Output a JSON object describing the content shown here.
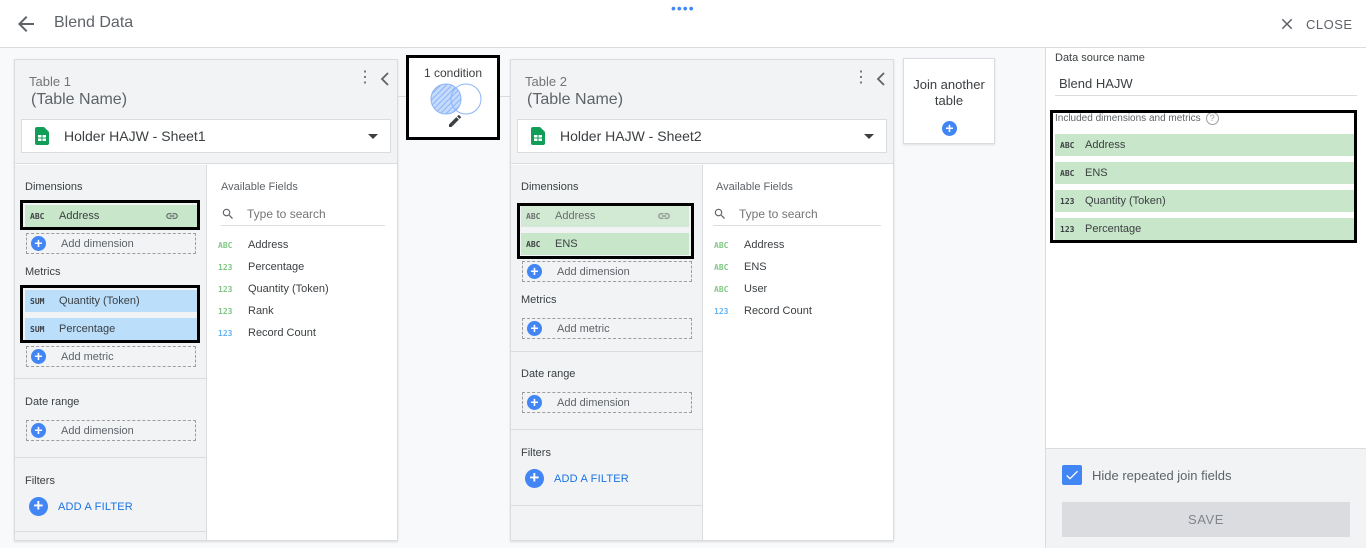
{
  "header": {
    "title": "Blend Data",
    "drag_handle": "••••",
    "close_label": "CLOSE"
  },
  "table1": {
    "label": "Table 1",
    "name": "(Table Name)",
    "source": "Holder HAJW - Sheet1",
    "dimensions_title": "Dimensions",
    "dimensions": [
      {
        "type": "ABC",
        "label": "Address"
      }
    ],
    "add_dimension": "Add dimension",
    "metrics_title": "Metrics",
    "metrics": [
      {
        "type": "SUM",
        "label": "Quantity (Token)"
      },
      {
        "type": "SUM",
        "label": "Percentage"
      }
    ],
    "add_metric": "Add metric",
    "date_range_title": "Date range",
    "date_add_dimension": "Add dimension",
    "filters_title": "Filters",
    "add_filter": "ADD A FILTER",
    "available_title": "Available Fields",
    "search_placeholder": "Type to search",
    "fields": [
      {
        "type": "ABC",
        "label": "Address"
      },
      {
        "type": "123",
        "label": "Percentage"
      },
      {
        "type": "123",
        "label": "Quantity (Token)"
      },
      {
        "type": "123",
        "label": "Rank"
      },
      {
        "type": "123",
        "label": "Record Count"
      }
    ]
  },
  "condition": {
    "label": "1 condition"
  },
  "table2": {
    "label": "Table 2",
    "name": "(Table Name)",
    "source": "Holder HAJW - Sheet2",
    "dimensions_title": "Dimensions",
    "dimensions": [
      {
        "type": "ABC",
        "label": "Address"
      },
      {
        "type": "ABC",
        "label": "ENS"
      }
    ],
    "add_dimension": "Add dimension",
    "metrics_title": "Metrics",
    "add_metric": "Add metric",
    "date_range_title": "Date range",
    "date_add_dimension": "Add dimension",
    "filters_title": "Filters",
    "add_filter": "ADD A FILTER",
    "available_title": "Available Fields",
    "search_placeholder": "Type to search",
    "fields": [
      {
        "type": "ABC",
        "label": "Address"
      },
      {
        "type": "ABC",
        "label": "ENS"
      },
      {
        "type": "ABC",
        "label": "User"
      },
      {
        "type": "123",
        "label": "Record Count"
      }
    ]
  },
  "join_another": {
    "label_line1": "Join another",
    "label_line2": "table"
  },
  "right_panel": {
    "ds_label": "Data source name",
    "ds_value": "Blend HAJW",
    "included_label": "Included dimensions and metrics",
    "help": "?",
    "included": [
      {
        "type": "ABC",
        "label": "Address"
      },
      {
        "type": "ABC",
        "label": "ENS"
      },
      {
        "type": "123",
        "label": "Quantity (Token)"
      },
      {
        "type": "123",
        "label": "Percentage"
      }
    ],
    "hide_repeated": "Hide repeated join fields",
    "save": "SAVE"
  },
  "colors": {
    "accent": "#4285f4",
    "dimension_chip": "#c8e6c9",
    "metric_chip": "#bbdefb",
    "highlight_border": "#000000"
  }
}
